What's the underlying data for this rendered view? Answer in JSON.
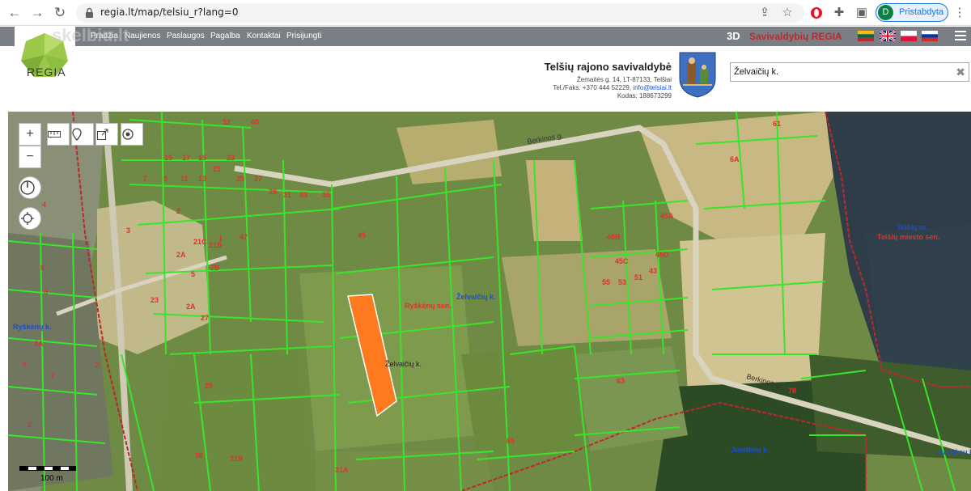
{
  "browser": {
    "back": "←",
    "forward": "→",
    "reload": "↻",
    "url": "regia.lt/map/telsiu_r?lang=0",
    "profile_initial": "D",
    "profile_label": "Pristabdyta"
  },
  "site_nav": {
    "links": [
      "Pradžia",
      "Naujienos",
      "Paslaugos",
      "Pagalba",
      "Kontaktai",
      "Prisijungti"
    ],
    "three_d": "3D",
    "brand": "Savivaldybių REGIA"
  },
  "header": {
    "logo_text": "REGIA",
    "watermark": "skelbiu.lt",
    "municipality_title": "Telšių rajono savivaldybė",
    "address": "Žemaitės g. 14, LT-87133, Telšiai",
    "phone_prefix": "Tel./Faks. +370 444 52229,",
    "email": "info@telsiai.lt",
    "code": "Kodas: 188673299"
  },
  "search": {
    "value": "Želvaičių k."
  },
  "map": {
    "scale_label": "100 m",
    "labels": {
      "berkinos_g_1": "Berkinos g.",
      "berkinos_g_2": "Berkinos g.",
      "ryskenu_sen": "Ryškėnų sen.",
      "zelvaiciu_k": "Želvaičių k.",
      "zelvaiciu_k_small": "Želvaičių k.",
      "ryskenu_k": "Ryškėnų k.",
      "telsiu_m": "Telšių m.",
      "telsiu_miesto_sen": "Telšių miesto sen.",
      "juodenu_k": "Juodėnų k.",
      "juodenu_k_2": "Juodėnų k."
    },
    "parcels": [
      "32",
      "40",
      "15",
      "17",
      "19",
      "21",
      "23",
      "7",
      "9",
      "11",
      "13",
      "25",
      "27",
      "29",
      "31",
      "33",
      "35",
      "3",
      "2",
      "21C",
      "21B",
      "1",
      "47",
      "45",
      "2A",
      "2B",
      "5",
      "23",
      "2A",
      "27",
      "25",
      "4",
      "8",
      "6",
      "2",
      "61",
      "6A",
      "45B",
      "45C",
      "45A",
      "45D",
      "55",
      "53",
      "51",
      "43",
      "63",
      "65",
      "78",
      "30",
      "31B",
      "31A",
      "3A",
      "5",
      "7",
      "2"
    ]
  },
  "colors": {
    "nav_bg": "#7a7f85",
    "brand_red": "#c0272d",
    "selected_parcel": "#ff7a1f",
    "parcel_outline": "#39e52b",
    "boundary": "#c0272d"
  }
}
